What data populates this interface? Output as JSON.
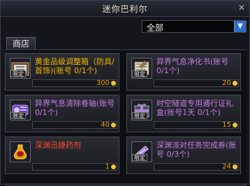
{
  "window": {
    "title": "迷你巴利尔",
    "close_label": "✕"
  },
  "filter": {
    "selected": "全部"
  },
  "tabs": [
    {
      "label": "商店"
    }
  ],
  "items": [
    {
      "name": "黄金品级调整箱（防具/首饰)(账号 0/1个)",
      "price": "300",
      "badge": "限定",
      "icon": "chest-icon",
      "color": "#f3b400"
    },
    {
      "name": "异界气息净化书(账号 0/1个)",
      "price": "20",
      "badge": "限定",
      "icon": "book-icon",
      "color": "#c77be7"
    },
    {
      "name": "异界气息清除卷轴(账号 0/1个)",
      "price": "40",
      "badge": "限定",
      "icon": "scroll-icon",
      "color": "#c77be7"
    },
    {
      "name": "时空隧道专用通行证礼盒(账号1天 0/1个)",
      "price": "15",
      "badge": "限定",
      "icon": "gift-box-icon",
      "color": "#c77be7"
    },
    {
      "name": "深渊迅捷药剂",
      "price": "1",
      "badge": "",
      "icon": "potion-icon",
      "color": "#ff4b2b"
    },
    {
      "name": "深渊派对任务完成券(账号 0/3个)",
      "price": "24",
      "badge": "限定",
      "icon": "ticket-icon",
      "color": "#c77be7"
    }
  ]
}
